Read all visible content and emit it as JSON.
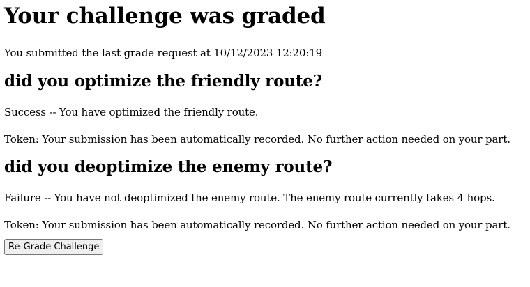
{
  "page": {
    "title": "Your challenge was graded",
    "submitted_text": "You submitted the last grade request at 10/12/2023 12:20:19"
  },
  "questions": [
    {
      "heading": "did you optimize the friendly route?",
      "status": "Success -- You have optimized the friendly route.",
      "token": "Token: Your submission has been automatically recorded. No further action needed on your part."
    },
    {
      "heading": "did you deoptimize the enemy route?",
      "status": "Failure -- You have not deoptimized the enemy route. The enemy route currently takes 4 hops.",
      "token": "Token: Your submission has been automatically recorded. No further action needed on your part."
    }
  ],
  "actions": {
    "regrade_label": "Re-Grade Challenge"
  }
}
